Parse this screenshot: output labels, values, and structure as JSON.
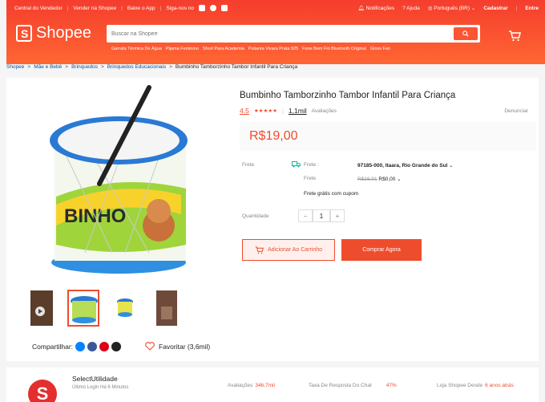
{
  "topbar": {
    "left": [
      "Central do Vendedor",
      "Vender na Shopee",
      "Baixe o App",
      "Siga-nos no"
    ],
    "notifications": "Notificações",
    "help": "Ajuda",
    "language": "Português (BR)",
    "register": "Cadastrar",
    "login": "Entre"
  },
  "brand": {
    "name": "Shopee",
    "logo_letter": "S"
  },
  "search": {
    "placeholder": "Buscar na Shopee",
    "keywords": [
      "Garrafa Térmica De Água",
      "Pijama Feminino",
      "Short Para Academia",
      "Pulseira Vivara Prata 925",
      "Fone Bem Fio Bluetooth Original",
      "Gloss Fan"
    ]
  },
  "breadcrumb": [
    "Shopee",
    "Mãe e Bebê",
    "Brinquedos",
    "Brinquedos Educacionais",
    "Bumbinho Tamborzinho Tambor Infantil Para Criança"
  ],
  "product": {
    "title": "Bumbinho Tamborzinho Tambor Infantil Para Criança",
    "rating": "4.5",
    "rating_value": 4.5,
    "stars": "★★★★★",
    "reviews_count": "1,1mil",
    "reviews_label": "Avaliações",
    "report": "Denunciar",
    "price": "R$19,00",
    "shipping_label": "Frete",
    "shipping_to_label": "Frete :",
    "shipping_to": "97185-000, Itaara, Rio Grande do Sul",
    "shipping_cost_label": "Frete",
    "shipping_old": "R$16,91",
    "shipping_new": "R$0,00",
    "free_shipping": "Frete grátis com cupom",
    "quantity_label": "Quantidade",
    "quantity": "1",
    "add_to_cart": "Adicionar Ao Carrinho",
    "buy_now": "Comprar Agora",
    "drum_text": "BINHO",
    "share_label": "Compartilhar:",
    "favorite_label": "Favoritar (3,6mil)"
  },
  "seller": {
    "name": "SelectUtilidade",
    "last_login": "Último Login Há 6 Minutos",
    "stats": [
      {
        "label": "Avaliações",
        "value": "346,7mil"
      },
      {
        "label": "Taxa De Resposta Do Chat",
        "value": "47%"
      },
      {
        "label": "Loja Shopee Desde",
        "value": "6 anos atrás"
      }
    ]
  },
  "colors": {
    "brand": "#ee4d2d",
    "link": "#0055aa"
  }
}
